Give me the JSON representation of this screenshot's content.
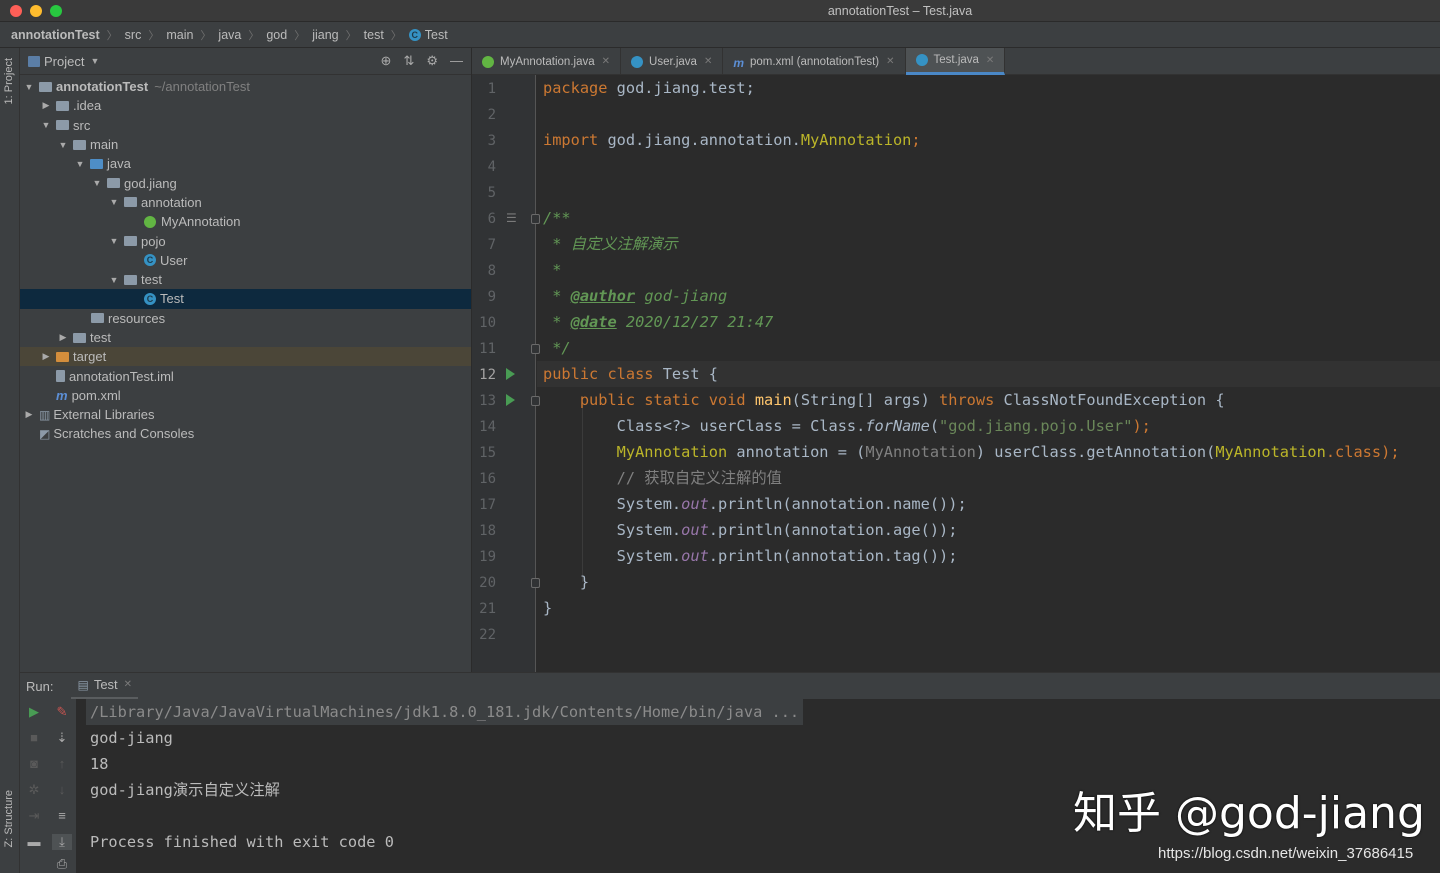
{
  "window": {
    "title": "annotationTest – Test.java"
  },
  "breadcrumb": {
    "items": [
      "annotationTest",
      "src",
      "main",
      "java",
      "god",
      "jiang",
      "test",
      "Test"
    ]
  },
  "left_strip": {
    "project_label": "1: Project",
    "structure_label": "Z: Structure"
  },
  "project_panel": {
    "title": "Project",
    "tree": [
      {
        "label": "annotationTest",
        "hint": "~/annotationTest"
      },
      {
        "label": ".idea"
      },
      {
        "label": "src"
      },
      {
        "label": "main"
      },
      {
        "label": "java"
      },
      {
        "label": "god.jiang"
      },
      {
        "label": "annotation"
      },
      {
        "label": "MyAnnotation"
      },
      {
        "label": "pojo"
      },
      {
        "label": "User"
      },
      {
        "label": "test"
      },
      {
        "label": "Test"
      },
      {
        "label": "resources"
      },
      {
        "label": "test"
      },
      {
        "label": "target"
      },
      {
        "label": "annotationTest.iml"
      },
      {
        "label": "pom.xml"
      },
      {
        "label": "External Libraries"
      },
      {
        "label": "Scratches and Consoles"
      }
    ]
  },
  "tabs": [
    {
      "label": "MyAnnotation.java",
      "icon": "annotation-icon"
    },
    {
      "label": "User.java",
      "icon": "class-icon"
    },
    {
      "label": "pom.xml (annotationTest)",
      "icon": "maven-icon"
    },
    {
      "label": "Test.java",
      "icon": "class-icon",
      "active": true
    }
  ],
  "editor": {
    "current_line": "12",
    "line_numbers": [
      "1",
      "2",
      "3",
      "4",
      "5",
      "6",
      "7",
      "8",
      "9",
      "10",
      "11",
      "12",
      "13",
      "14",
      "15",
      "16",
      "17",
      "18",
      "19",
      "20",
      "21",
      "22"
    ],
    "code": {
      "l1_kw": "package",
      "l1_rest": " god.jiang.test;",
      "l3_kw": "import",
      "l3_pkg": " god.jiang.annotation.",
      "l3_ann": "MyAnnotation",
      "l3_end": ";",
      "l6": "/**",
      "l7": " * 自定义注解演示",
      "l8": " *",
      "l9_star": " * ",
      "l9_tag": "@author",
      "l9_val": " god-jiang",
      "l10_star": " * ",
      "l10_tag": "@date",
      "l10_val": " 2020/12/27 21:47",
      "l11": " */",
      "l12_kw": "public class",
      "l12_name": " Test {",
      "l13_kw": "    public static void",
      "l13_fn": " main",
      "l13_args": "(String[] args) ",
      "l13_throws": "throws",
      "l13_rest": " ClassNotFoundException {",
      "l14_a": "        Class<?> userClass = Class.",
      "l14_fn": "forName",
      "l14_p": "(",
      "l14_str": "\"god.jiang.pojo.User\"",
      "l14_end": ");",
      "l15_ann": "        MyAnnotation",
      "l15_a": " annotation = (",
      "l15_cast": "MyAnnotation",
      "l15_b": ") userClass.getAnnotation(",
      "l15_ann2": "MyAnnotation",
      "l15_kw": ".class",
      "l15_end": ");",
      "l16": "        // 获取自定义注解的值",
      "l17_a": "        System.",
      "l17_out": "out",
      "l17_b": ".println(annotation.name());",
      "l18_a": "        System.",
      "l18_out": "out",
      "l18_b": ".println(annotation.age());",
      "l19_a": "        System.",
      "l19_out": "out",
      "l19_b": ".println(annotation.tag());",
      "l20": "    }",
      "l21": "}"
    }
  },
  "run": {
    "label": "Run:",
    "tab": "Test",
    "output": [
      "/Library/Java/JavaVirtualMachines/jdk1.8.0_181.jdk/Contents/Home/bin/java ...",
      "god-jiang",
      "18",
      "god-jiang演示自定义注解",
      "",
      "Process finished with exit code 0"
    ]
  },
  "watermark": {
    "text": "知乎 @god-jiang",
    "url": "https://blog.csdn.net/weixin_37686415"
  },
  "colors": {
    "accent": "#4a88c7",
    "keyword": "#cc7832",
    "doc": "#629755",
    "string": "#6a8759",
    "selection": "#0d293e"
  }
}
